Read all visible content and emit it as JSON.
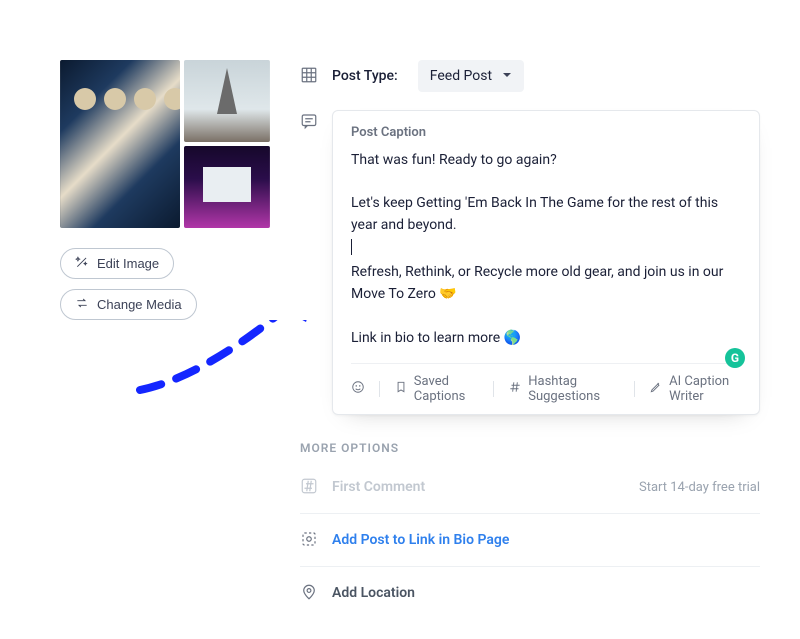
{
  "post_type": {
    "label": "Post Type:",
    "selected": "Feed Post"
  },
  "buttons": {
    "edit_image": "Edit Image",
    "change_media": "Change Media"
  },
  "caption": {
    "title": "Post Caption",
    "p1": "That was fun! Ready to go again?",
    "p2": "Let's keep Getting 'Em Back In The Game for the rest of this year and beyond.",
    "p3": "Refresh, Rethink, or Recycle more old gear, and join us in our Move To Zero 🤝",
    "p4": "Link in bio to learn more 🌎",
    "grammarly": "G",
    "toolbar": {
      "emoji": "emoji",
      "saved_captions": "Saved Captions",
      "hashtag_suggestions": "Hashtag Suggestions",
      "ai_caption_writer": "AI Caption Writer"
    }
  },
  "more": {
    "label": "MORE OPTIONS",
    "first_comment": "First Comment",
    "first_comment_trail": "Start 14-day free trial",
    "linkinbio": "Add Post to Link in Bio Page",
    "location": "Add Location"
  }
}
